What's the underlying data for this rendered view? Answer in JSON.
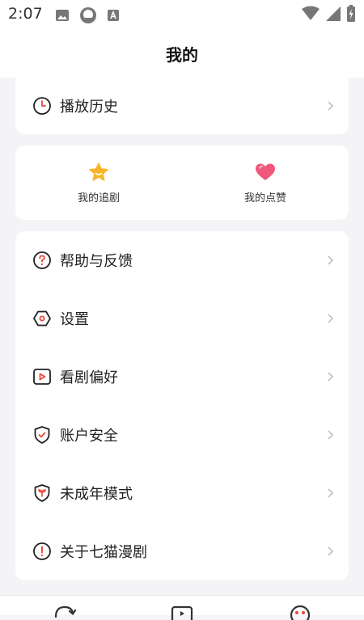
{
  "status": {
    "time": "2:07"
  },
  "header": {
    "title": "我的"
  },
  "history": {
    "label": "播放历史"
  },
  "favorites": [
    {
      "label": "我的追剧",
      "icon": "star-icon",
      "color": "#f7b52b"
    },
    {
      "label": "我的点赞",
      "icon": "heart-icon",
      "color": "#f0577a"
    }
  ],
  "menu": [
    {
      "label": "帮助与反馈",
      "icon": "help-icon"
    },
    {
      "label": "设置",
      "icon": "settings-icon"
    },
    {
      "label": "看剧偏好",
      "icon": "play-icon"
    },
    {
      "label": "账户安全",
      "icon": "shield-icon"
    },
    {
      "label": "未成年模式",
      "icon": "youth-mode-icon"
    },
    {
      "label": "关于七猫漫剧",
      "icon": "info-icon"
    }
  ],
  "colors": {
    "accent": "#e8493a",
    "background": "#f4f4f6",
    "text": "#222222"
  }
}
